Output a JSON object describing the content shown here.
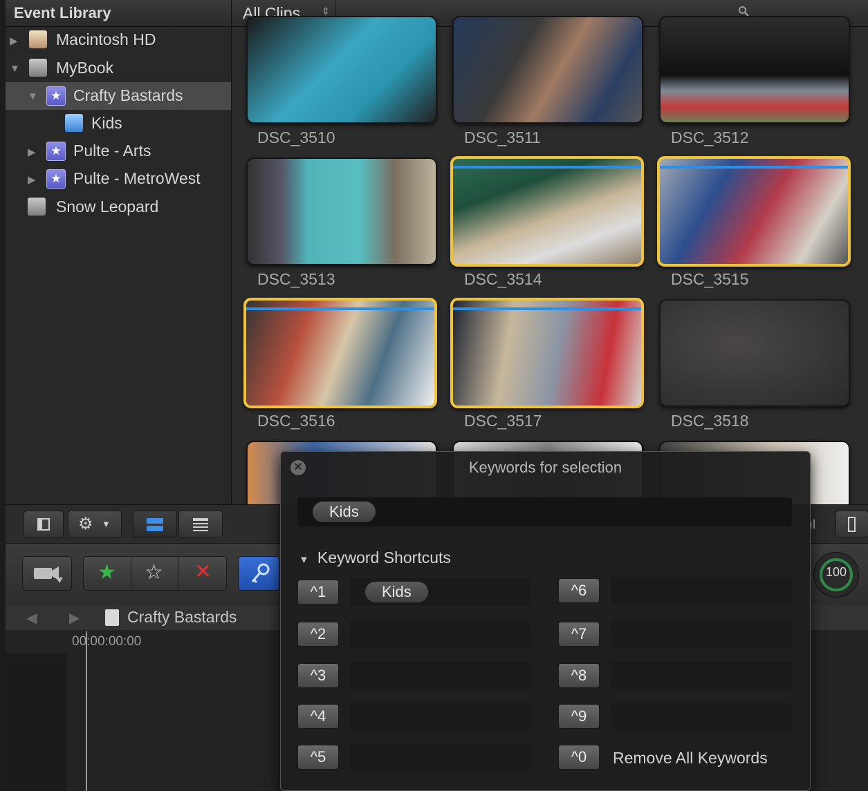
{
  "library": {
    "title": "Event Library",
    "items": [
      {
        "label": "Macintosh HD",
        "icon": "house-drive-icon",
        "selected": false
      },
      {
        "label": "MyBook",
        "icon": "external-drive-icon",
        "selected": false
      },
      {
        "label": "Crafty Bastards",
        "icon": "event-star-icon",
        "selected": true
      },
      {
        "label": "Kids",
        "icon": "keyword-collection-icon",
        "selected": false
      },
      {
        "label": "Pulte - Arts",
        "icon": "event-star-icon",
        "selected": false
      },
      {
        "label": "Pulte - MetroWest",
        "icon": "event-star-icon",
        "selected": false
      },
      {
        "label": "Snow Leopard",
        "icon": "drive-icon",
        "selected": false
      }
    ]
  },
  "browser": {
    "filter": "All Clips",
    "clips": [
      {
        "name": "DSC_3510",
        "selected": false
      },
      {
        "name": "DSC_3511",
        "selected": false
      },
      {
        "name": "DSC_3512",
        "selected": false
      },
      {
        "name": "DSC_3513",
        "selected": false
      },
      {
        "name": "DSC_3514",
        "selected": true
      },
      {
        "name": "DSC_3515",
        "selected": true
      },
      {
        "name": "DSC_3516",
        "selected": true
      },
      {
        "name": "DSC_3517",
        "selected": true
      },
      {
        "name": "DSC_3518",
        "selected": false
      }
    ]
  },
  "timeline": {
    "project_title": "Crafty Bastards",
    "timecode": "00:00:00:00",
    "zoom": "100"
  },
  "hud": {
    "title": "Keywords for selection",
    "keywords": [
      "Kids"
    ],
    "shortcuts_heading": "Keyword Shortcuts",
    "shortcuts": [
      {
        "key": "^1",
        "keyword": "Kids"
      },
      {
        "key": "^2",
        "keyword": ""
      },
      {
        "key": "^3",
        "keyword": ""
      },
      {
        "key": "^4",
        "keyword": ""
      },
      {
        "key": "^5",
        "keyword": ""
      },
      {
        "key": "^6",
        "keyword": ""
      },
      {
        "key": "^7",
        "keyword": ""
      },
      {
        "key": "^8",
        "keyword": ""
      },
      {
        "key": "^9",
        "keyword": ""
      },
      {
        "key": "^0",
        "keyword": ""
      }
    ],
    "remove_all_label": "Remove All Keywords"
  },
  "colors": {
    "selection": "#f0c43a",
    "keyword_line": "#2e8fe6",
    "event_icon": "#7070e0"
  }
}
